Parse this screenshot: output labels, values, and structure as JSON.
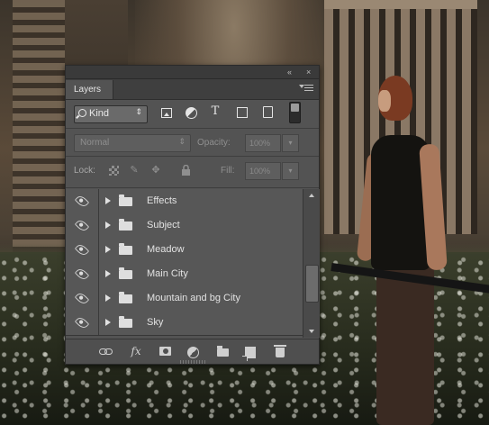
{
  "panel": {
    "collapse_glyph": "«",
    "close_glyph": "×",
    "tab_label": "Layers",
    "menu_icon": "panel-menu-icon"
  },
  "filter": {
    "kind_label": "Kind",
    "kind_arrow": "⇕",
    "type_icon_label": "T",
    "icons": [
      "filter-pixel-icon",
      "filter-adjustment-icon",
      "filter-type-icon",
      "filter-shape-icon",
      "filter-smart-object-icon",
      "filter-toggle-switch"
    ]
  },
  "blend": {
    "mode": "Normal",
    "mode_arrow": "⇕",
    "opacity_label": "Opacity:",
    "opacity_value": "100%",
    "opacity_button": "▾"
  },
  "lock": {
    "label": "Lock:",
    "fill_label": "Fill:",
    "fill_value": "100%",
    "fill_button": "▾",
    "brush_glyph": "✎",
    "move_glyph": "✥",
    "icons": [
      "lock-transparent-pixels-icon",
      "lock-image-pixels-icon",
      "lock-position-icon",
      "lock-all-icon"
    ]
  },
  "layers": [
    {
      "name": "Effects",
      "visible": true,
      "type": "group"
    },
    {
      "name": "Subject",
      "visible": true,
      "type": "group"
    },
    {
      "name": "Meadow",
      "visible": true,
      "type": "group"
    },
    {
      "name": "Main City",
      "visible": true,
      "type": "group"
    },
    {
      "name": "Mountain and bg City",
      "visible": true,
      "type": "group"
    },
    {
      "name": "Sky",
      "visible": true,
      "type": "group"
    }
  ],
  "footer": {
    "fx_label": "fx",
    "icons": [
      "link-layers-icon",
      "layer-style-icon",
      "add-mask-icon",
      "new-adjustment-layer-icon",
      "new-group-icon",
      "new-layer-icon",
      "delete-layer-icon"
    ]
  },
  "colors": {
    "panel_bg": "#535353",
    "title_bar": "#3a3a3a",
    "layer_row": "#575757",
    "text": "#e2e2e2"
  }
}
